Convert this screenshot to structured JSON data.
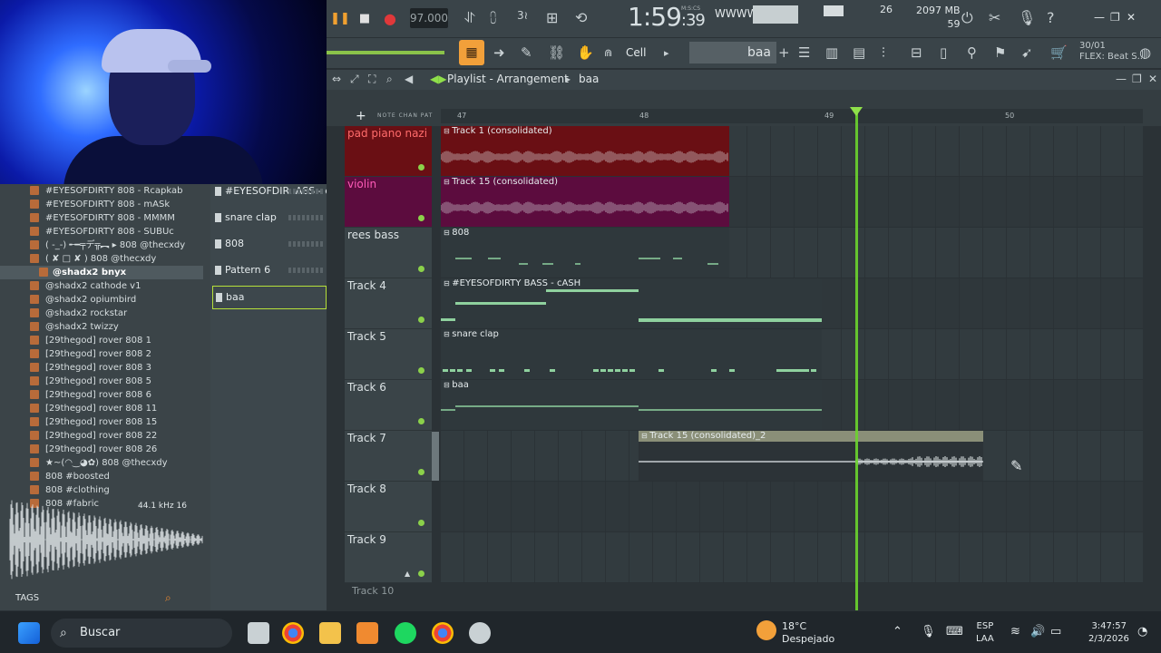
{
  "transport": {
    "play_icon": "pause-icon",
    "stop_icon": "stop-icon",
    "record_icon": "record-icon",
    "tempo": "97.000",
    "time_main": "1:59",
    "time_sub": ":39",
    "time_unit": "M:S:CS",
    "waveform_label": "WWWW",
    "polyphony": "26",
    "cpu_mem": "2097 MB",
    "cpu_num": "59"
  },
  "toolbar2": {
    "snap": "Cell",
    "pattern": "baa",
    "flex_count": "30/01",
    "flex_label": "FLEX: Beat S..."
  },
  "browser": {
    "items": [
      {
        "label": "#EYESOFDIRTY 808 - Rcapkab"
      },
      {
        "label": "#EYESOFDIRTY 808 - mASk"
      },
      {
        "label": "#EYESOFDIRTY 808 - MMMM"
      },
      {
        "label": "#EYESOFDIRTY 808 - SUBUc"
      },
      {
        "label": "( -_-) ╾━╤デ╦︻ ▸ 808 @thecxdy"
      },
      {
        "label": "( ✘ □ ✘ ) 808 @thecxdy"
      },
      {
        "label": "@shadx2 bnyx"
      },
      {
        "label": "@shadx2 cathode v1"
      },
      {
        "label": "@shadx2 opiumbird"
      },
      {
        "label": "@shadx2 rockstar"
      },
      {
        "label": "@shadx2 twizzy"
      },
      {
        "label": "[29thegod] rover 808 1"
      },
      {
        "label": "[29thegod] rover 808 2"
      },
      {
        "label": "[29thegod] rover 808 3"
      },
      {
        "label": "[29thegod] rover 808 5"
      },
      {
        "label": "[29thegod] rover 808 6"
      },
      {
        "label": "[29thegod] rover 808 11"
      },
      {
        "label": "[29thegod] rover 808 15"
      },
      {
        "label": "[29thegod] rover 808 22"
      },
      {
        "label": "[29thegod] rover 808 26"
      },
      {
        "label": "★~(◠‿◕✿) 808 @thecxdy"
      },
      {
        "label": "808 #boosted"
      },
      {
        "label": "808 #clothing"
      },
      {
        "label": "808 #fabric"
      }
    ],
    "selected_index": 6,
    "sample_info": "44.1 kHz 16",
    "tags_label": "TAGS"
  },
  "channels": [
    {
      "label": "#EYESOFDIR..ASS - cASH"
    },
    {
      "label": "snare clap"
    },
    {
      "label": "808"
    },
    {
      "label": "Pattern 6"
    },
    {
      "label": "baa"
    }
  ],
  "playlist": {
    "title": "Playlist - Arrangement",
    "crumb": "baa",
    "ruler": [
      "47",
      "48",
      "49",
      "50"
    ],
    "tracks": [
      {
        "name": "pad piano nazi",
        "clip": "Track 1 (consolidated)"
      },
      {
        "name": "violin",
        "clip": "Track 15 (consolidated)"
      },
      {
        "name": "rees bass",
        "clip": "808"
      },
      {
        "name": "Track 4",
        "clip": "#EYESOFDIRTY BASS - cASH"
      },
      {
        "name": "Track 5",
        "clip": "snare clap"
      },
      {
        "name": "Track 6",
        "clip": "baa"
      },
      {
        "name": "Track 7",
        "clip": "Track 15 (consolidated)_2"
      },
      {
        "name": "Track 8",
        "clip": ""
      },
      {
        "name": "Track 9",
        "clip": ""
      }
    ],
    "track10": "Track 10"
  },
  "taskbar": {
    "search_placeholder": "Buscar",
    "weather_temp": "18°C",
    "weather_desc": "Despejado",
    "lang_top": "ESP",
    "lang_bottom": "LAA",
    "clock_time": "3:47:57",
    "clock_date": "2/3/2026"
  },
  "colors": {
    "accent_green": "#6bd42e",
    "accent_orange": "#f2a03a",
    "record_red": "#e0383a",
    "clip_red": "#6a0f14",
    "clip_magenta": "#5c0c3e"
  }
}
